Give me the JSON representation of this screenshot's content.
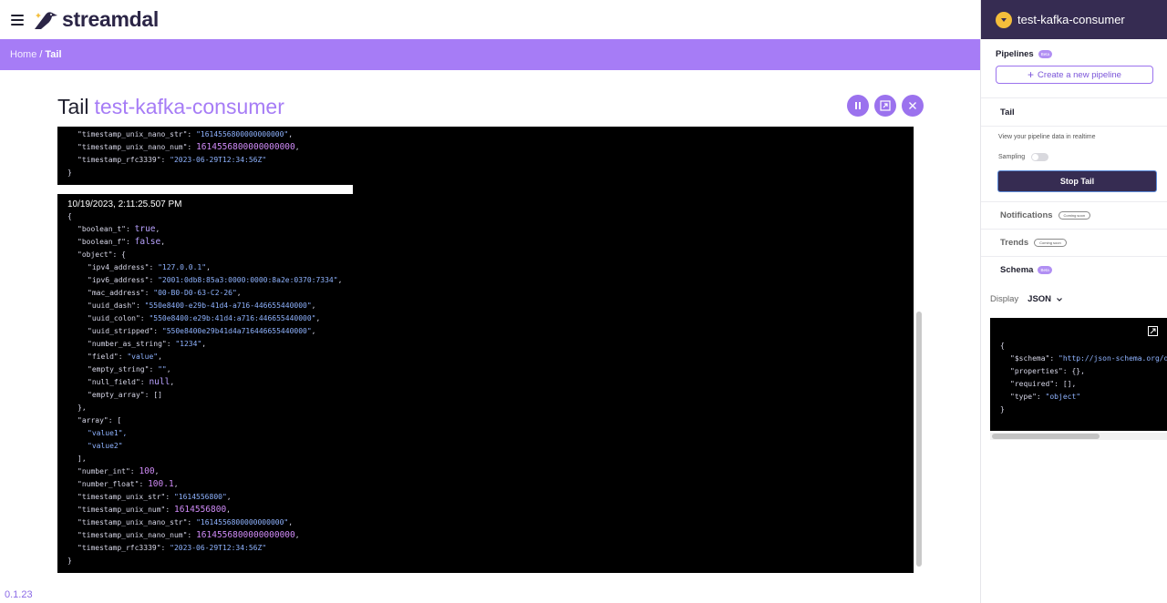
{
  "app": {
    "name": "streamdal",
    "version": "0.1.23"
  },
  "breadcrumb": {
    "home": "Home",
    "separator": "/",
    "current": "Tail"
  },
  "page": {
    "title": "Tail",
    "consumer": "test-kafka-consumer"
  },
  "controls": {
    "pause_icon": "pause-icon",
    "fullscreen_icon": "expand-icon",
    "close_icon": "close-icon"
  },
  "tail": {
    "top_lines": [
      {
        "key": "\"timestamp_unix_nano_str\"",
        "value": "\"1614556800000000000\"",
        "type": "s",
        "indent": 1,
        "comma": true
      },
      {
        "key": "\"timestamp_unix_nano_num\"",
        "value": "1614556800000000000",
        "type": "n",
        "indent": 1,
        "comma": true
      },
      {
        "key": "\"timestamp_rfc3339\"",
        "value": "\"2023-06-29T12:34:56Z\"",
        "type": "s",
        "indent": 1,
        "comma": false
      },
      {
        "raw": "}",
        "indent": 0
      }
    ],
    "record_time": "10/19/2023, 2:11:25.507 PM",
    "main_lines": [
      {
        "raw": "{",
        "indent": 0
      },
      {
        "key": "\"boolean_t\"",
        "value": "true",
        "type": "b",
        "indent": 1,
        "comma": true
      },
      {
        "key": "\"boolean_f\"",
        "value": "false",
        "type": "b",
        "indent": 1,
        "comma": true
      },
      {
        "key": "\"object\"",
        "value": "{",
        "type": "p",
        "indent": 1,
        "comma": false
      },
      {
        "key": "\"ipv4_address\"",
        "value": "\"127.0.0.1\"",
        "type": "s",
        "indent": 2,
        "comma": true
      },
      {
        "key": "\"ipv6_address\"",
        "value": "\"2001:0db8:85a3:0000:0000:8a2e:0370:7334\"",
        "type": "s",
        "indent": 2,
        "comma": true
      },
      {
        "key": "\"mac_address\"",
        "value": "\"00-B0-D0-63-C2-26\"",
        "type": "s",
        "indent": 2,
        "comma": true
      },
      {
        "key": "\"uuid_dash\"",
        "value": "\"550e8400-e29b-41d4-a716-446655440000\"",
        "type": "s",
        "indent": 2,
        "comma": true
      },
      {
        "key": "\"uuid_colon\"",
        "value": "\"550e8400:e29b:41d4:a716:446655440000\"",
        "type": "s",
        "indent": 2,
        "comma": true
      },
      {
        "key": "\"uuid_stripped\"",
        "value": "\"550e8400e29b41d4a716446655440000\"",
        "type": "s",
        "indent": 2,
        "comma": true
      },
      {
        "key": "\"number_as_string\"",
        "value": "\"1234\"",
        "type": "s",
        "indent": 2,
        "comma": true
      },
      {
        "key": "\"field\"",
        "value": "\"value\"",
        "type": "s",
        "indent": 2,
        "comma": true
      },
      {
        "key": "\"empty_string\"",
        "value": "\"\"",
        "type": "s",
        "indent": 2,
        "comma": true
      },
      {
        "key": "\"null_field\"",
        "value": "null",
        "type": "b",
        "indent": 2,
        "comma": true
      },
      {
        "key": "\"empty_array\"",
        "value": "[]",
        "type": "p",
        "indent": 2,
        "comma": false
      },
      {
        "raw": "},",
        "indent": 1
      },
      {
        "key": "\"array\"",
        "value": "[",
        "type": "p",
        "indent": 1,
        "comma": false
      },
      {
        "raw_s": "\"value1\",",
        "indent": 2
      },
      {
        "raw_s": "\"value2\"",
        "indent": 2
      },
      {
        "raw": "],",
        "indent": 1
      },
      {
        "key": "\"number_int\"",
        "value": "100",
        "type": "n",
        "indent": 1,
        "comma": true
      },
      {
        "key": "\"number_float\"",
        "value": "100.1",
        "type": "n",
        "indent": 1,
        "comma": true
      },
      {
        "key": "\"timestamp_unix_str\"",
        "value": "\"1614556800\"",
        "type": "s",
        "indent": 1,
        "comma": true
      },
      {
        "key": "\"timestamp_unix_num\"",
        "value": "1614556800",
        "type": "n",
        "indent": 1,
        "comma": true
      },
      {
        "key": "\"timestamp_unix_nano_str\"",
        "value": "\"1614556800000000000\"",
        "type": "s",
        "indent": 1,
        "comma": true
      },
      {
        "key": "\"timestamp_unix_nano_num\"",
        "value": "1614556800000000000",
        "type": "n",
        "indent": 1,
        "comma": true
      },
      {
        "key": "\"timestamp_rfc3339\"",
        "value": "\"2023-06-29T12:34:56Z\"",
        "type": "s",
        "indent": 1,
        "comma": false
      },
      {
        "raw": "}",
        "indent": 0
      }
    ]
  },
  "sidebar": {
    "title": "test-kafka-consumer",
    "status_icon": "chevron-down-icon",
    "status_color": "#f4be3b",
    "pipelines_label": "Pipelines",
    "beta_label": "Beta",
    "create_pipeline_label": "Create a new pipeline",
    "tail_label": "Tail",
    "tail_description": "View your pipeline data in realtime",
    "sampling_label": "Sampling",
    "sampling_enabled": false,
    "stop_tail_label": "Stop Tail",
    "notifications_label": "Notifications",
    "trends_label": "Trends",
    "coming_soon_label": "Coming soon",
    "schema_label": "Schema",
    "display_label": "Display",
    "display_value": "JSON"
  },
  "schema": {
    "lines": [
      {
        "raw": "{",
        "indent": 0
      },
      {
        "key": "\"$schema\"",
        "value": "\"http://json-schema.org/draft-07/schema#\"",
        "type": "s",
        "indent": 1,
        "comma": true
      },
      {
        "key": "\"properties\"",
        "value": "{}",
        "type": "p",
        "indent": 1,
        "comma": true
      },
      {
        "key": "\"required\"",
        "value": "[]",
        "type": "p",
        "indent": 1,
        "comma": true
      },
      {
        "key": "\"type\"",
        "value": "\"object\"",
        "type": "s",
        "indent": 1,
        "comma": false
      },
      {
        "raw": "}",
        "indent": 0
      }
    ]
  },
  "colors": {
    "accent": "#a67cf6",
    "sidebar_header": "#362c52",
    "panel": "#000000"
  }
}
